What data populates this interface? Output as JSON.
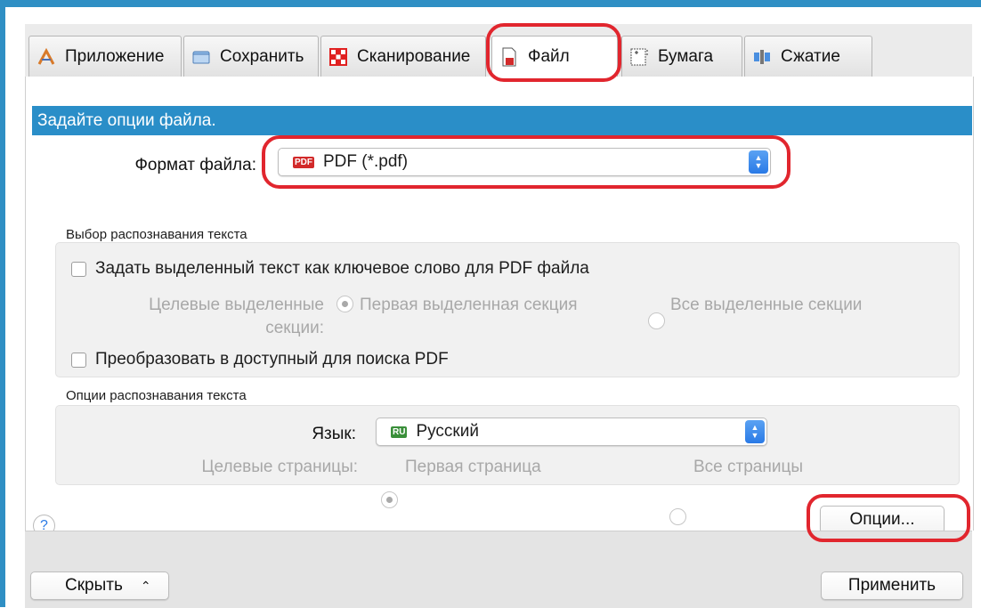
{
  "tabs": [
    {
      "label": "Приложение",
      "icon": "application-icon"
    },
    {
      "label": "Сохранить",
      "icon": "folder-icon"
    },
    {
      "label": "Сканирование",
      "icon": "scan-icon"
    },
    {
      "label": "Файл",
      "icon": "file-icon"
    },
    {
      "label": "Бумага",
      "icon": "paper-icon"
    },
    {
      "label": "Сжатие",
      "icon": "compression-icon"
    }
  ],
  "active_tab": "Файл",
  "section_header": "Задайте опции файла.",
  "file_format": {
    "label": "Формат файла:",
    "badge": "PDF",
    "value": "PDF (*.pdf)"
  },
  "text_recognition_selection": {
    "title": "Выбор распознавания текста",
    "keyword_checkbox": "Задать выделенный текст как ключевое слово для PDF файла",
    "target_label_line1": "Целевые выделенные",
    "target_label_line2": "секции:",
    "option_first": "Первая выделенная секция",
    "option_all": "Все выделенные секции",
    "searchable_checkbox": "Преобразовать в доступный для поиска PDF"
  },
  "text_recognition_options": {
    "title": "Опции распознавания текста",
    "language_label": "Язык:",
    "language_badge": "RU",
    "language_value": "Русский",
    "pages_label": "Целевые страницы:",
    "pages_first": "Первая страница",
    "pages_all": "Все страницы"
  },
  "buttons": {
    "help": "?",
    "options": "Опции...",
    "hide": "Скрыть",
    "apply": "Применить"
  },
  "colors": {
    "header_blue": "#2a8ec8",
    "highlight_red": "#e1262e",
    "stepper_blue": "#2a7ae6"
  }
}
